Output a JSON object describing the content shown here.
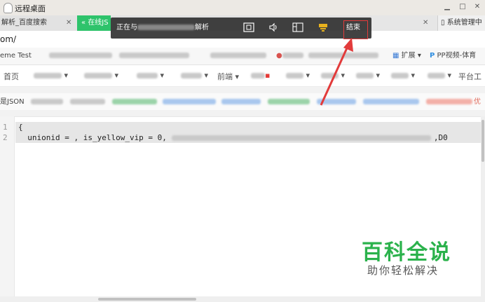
{
  "window": {
    "title": "远程桌面",
    "minimize_glyph": "▁",
    "maximize_glyph": "□",
    "close_glyph": "✕"
  },
  "tabs": [
    {
      "label": "解析_百度搜索",
      "close": "✕"
    },
    {
      "label": "在线JS",
      "active": true
    },
    {
      "label": "系统管理中",
      "close": "✕"
    }
  ],
  "rdp_bar": {
    "status_prefix": "正在与",
    "status_suffix": "解析",
    "end_label": "结束",
    "icons": [
      "fullscreen-icon",
      "audio-icon",
      "screen-split-icon",
      "keyboard-icon"
    ],
    "highlight_color": "#e23b3b"
  },
  "address": {
    "url": "om/"
  },
  "bookmarks": {
    "first": "eme Test",
    "mid": "pp视频",
    "extensions_label": "扩展",
    "pp_label": "PP视频-体育"
  },
  "sitenav": {
    "home": "首页",
    "forward": "前端",
    "tools": "平台工"
  },
  "toollinks": {
    "first": "是JSON",
    "last_fragment": "优"
  },
  "editor": {
    "line_numbers": [
      "1",
      "2"
    ],
    "line1": "{",
    "line2_visible": "  unionid = , is_yellow_vip = 0,",
    "line2_tail": ",D0"
  },
  "watermark": {
    "title": "百科全说",
    "subtitle": "助你轻松解决",
    "color": "#2bb24c"
  }
}
